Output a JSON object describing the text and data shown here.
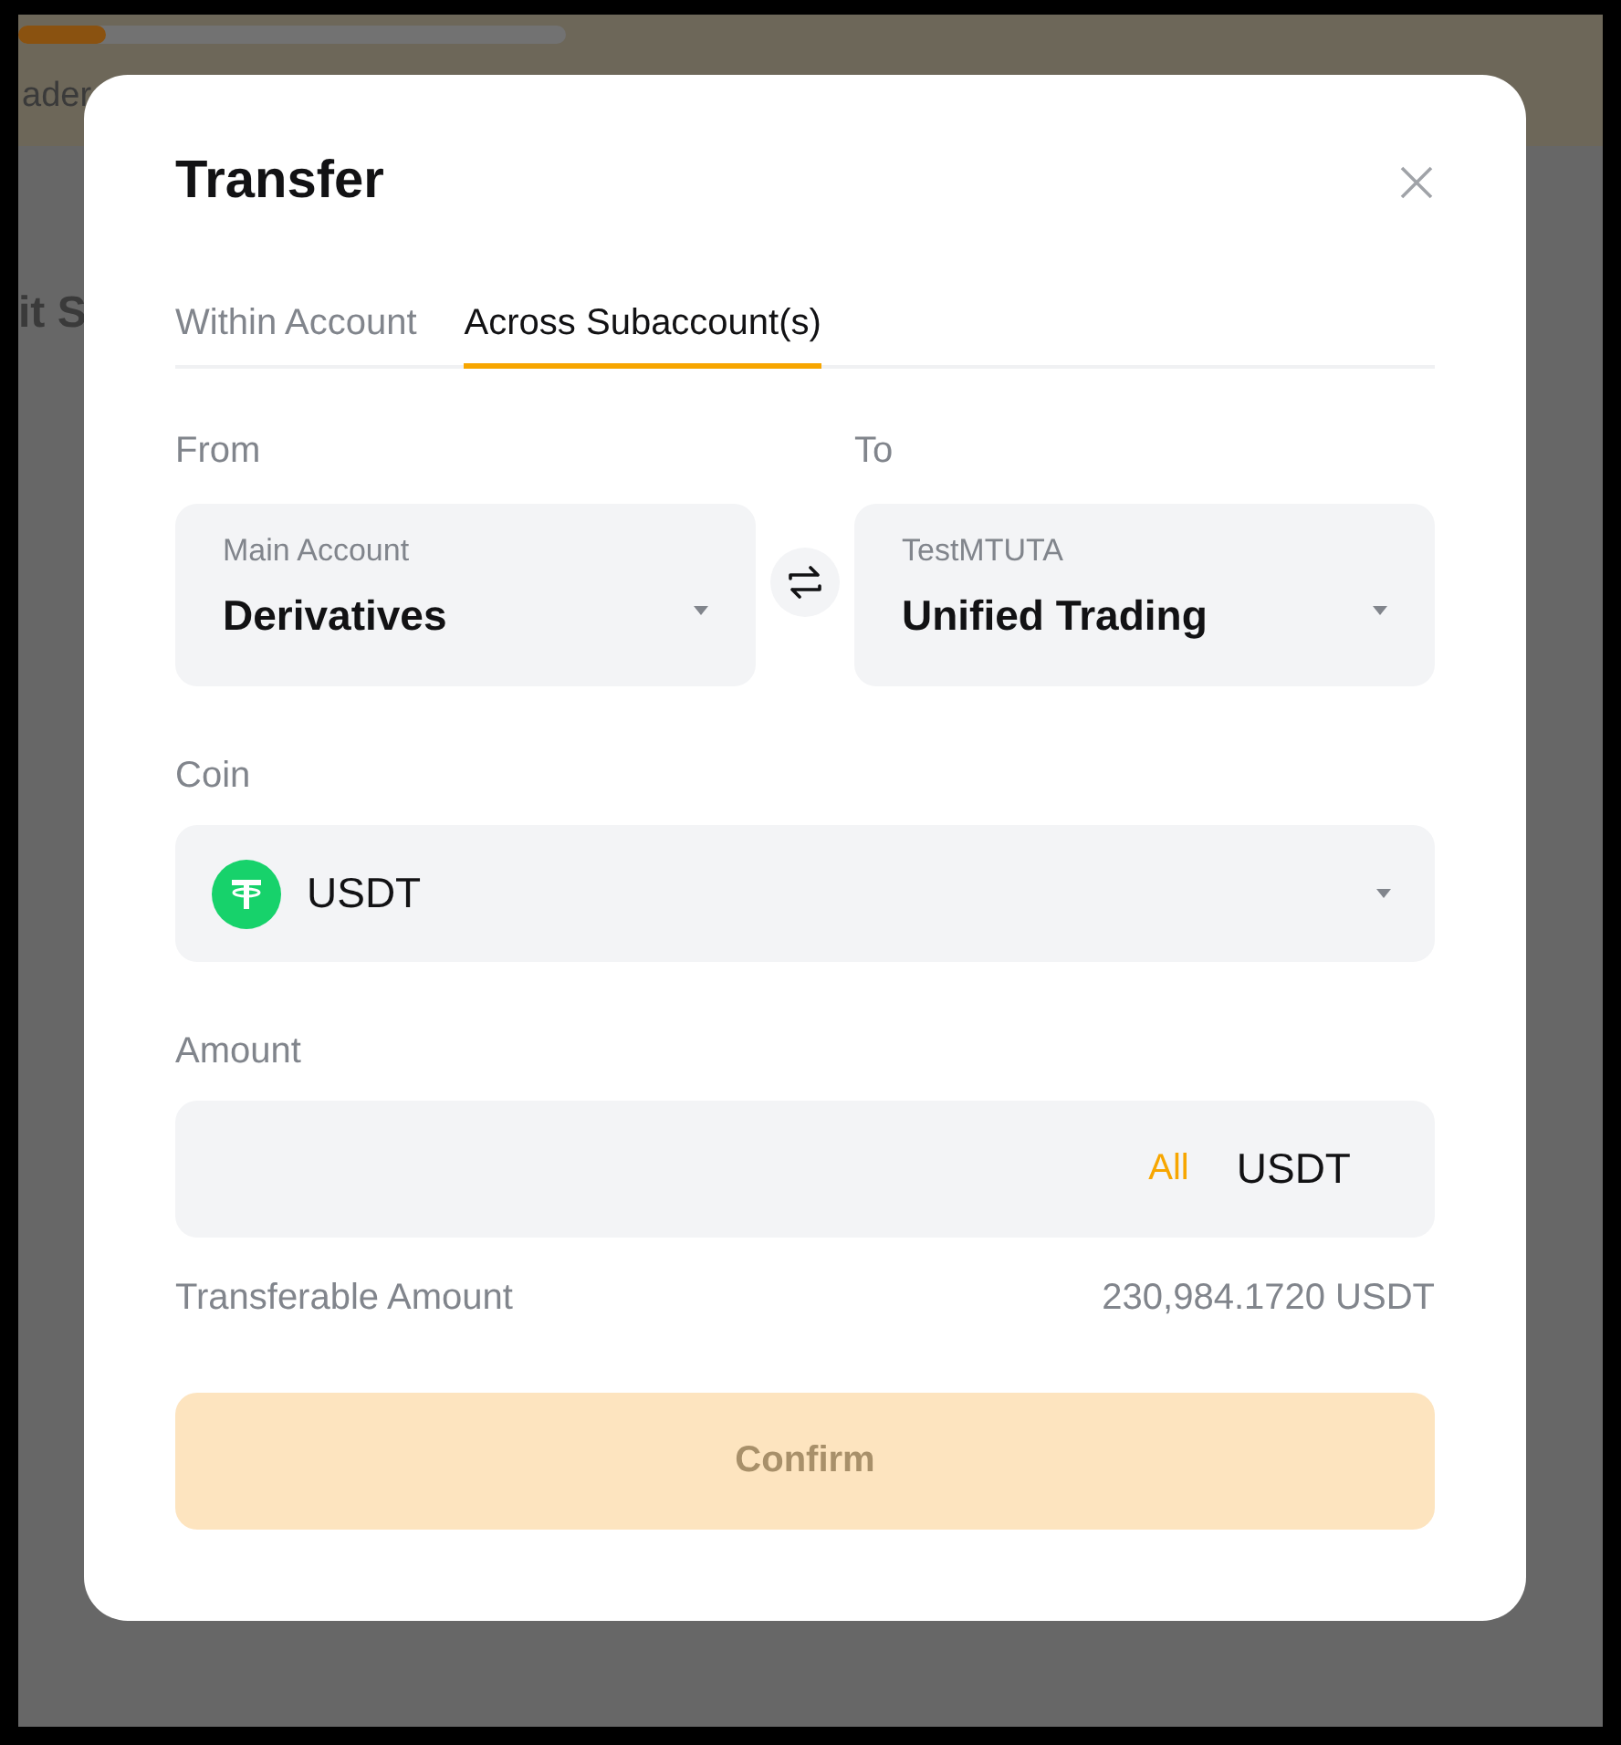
{
  "background": {
    "texts": [
      "ader",
      "it S"
    ]
  },
  "dialog": {
    "title": "Transfer",
    "tabs": [
      {
        "label": "Within Account",
        "selected": false
      },
      {
        "label": "Across Subaccount(s)",
        "selected": true
      }
    ],
    "from": {
      "label": "From",
      "account": "Main Account",
      "wallet": "Derivatives"
    },
    "to": {
      "label": "To",
      "account": "TestMTUTA",
      "wallet": "Unified Trading"
    },
    "coin": {
      "label": "Coin",
      "value": "USDT"
    },
    "amount": {
      "label": "Amount",
      "all": "All",
      "unit": "USDT"
    },
    "transferable": {
      "label": "Transferable Amount",
      "value": "230,984.1720 USDT"
    },
    "confirm": {
      "label": "Confirm",
      "disabled": true
    }
  }
}
